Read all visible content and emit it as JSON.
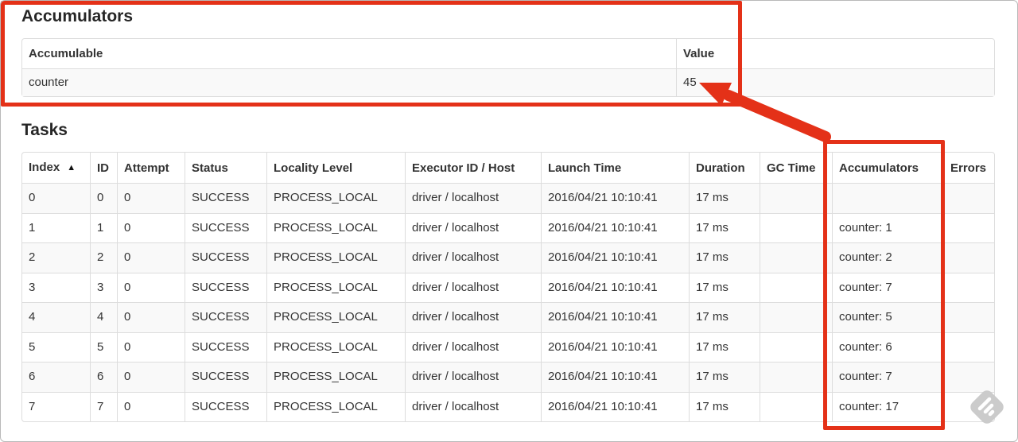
{
  "accumulators_section": {
    "heading": "Accumulators",
    "table": {
      "headers": [
        "Accumulable",
        "Value"
      ],
      "rows": [
        {
          "accumulable": "counter",
          "value": "45"
        }
      ]
    }
  },
  "tasks_section": {
    "heading": "Tasks",
    "table": {
      "headers": [
        "Index",
        "ID",
        "Attempt",
        "Status",
        "Locality Level",
        "Executor ID / Host",
        "Launch Time",
        "Duration",
        "GC Time",
        "Accumulators",
        "Errors"
      ],
      "sort": {
        "column": "Index",
        "direction": "asc",
        "icon": "▲"
      },
      "rows": [
        {
          "index": "0",
          "id": "0",
          "attempt": "0",
          "status": "SUCCESS",
          "locality_level": "PROCESS_LOCAL",
          "executor_id_host": "driver / localhost",
          "launch_time": "2016/04/21 10:10:41",
          "duration": "17 ms",
          "gc_time": "",
          "accumulators": "",
          "errors": ""
        },
        {
          "index": "1",
          "id": "1",
          "attempt": "0",
          "status": "SUCCESS",
          "locality_level": "PROCESS_LOCAL",
          "executor_id_host": "driver / localhost",
          "launch_time": "2016/04/21 10:10:41",
          "duration": "17 ms",
          "gc_time": "",
          "accumulators": "counter: 1",
          "errors": ""
        },
        {
          "index": "2",
          "id": "2",
          "attempt": "0",
          "status": "SUCCESS",
          "locality_level": "PROCESS_LOCAL",
          "executor_id_host": "driver / localhost",
          "launch_time": "2016/04/21 10:10:41",
          "duration": "17 ms",
          "gc_time": "",
          "accumulators": "counter: 2",
          "errors": ""
        },
        {
          "index": "3",
          "id": "3",
          "attempt": "0",
          "status": "SUCCESS",
          "locality_level": "PROCESS_LOCAL",
          "executor_id_host": "driver / localhost",
          "launch_time": "2016/04/21 10:10:41",
          "duration": "17 ms",
          "gc_time": "",
          "accumulators": "counter: 7",
          "errors": ""
        },
        {
          "index": "4",
          "id": "4",
          "attempt": "0",
          "status": "SUCCESS",
          "locality_level": "PROCESS_LOCAL",
          "executor_id_host": "driver / localhost",
          "launch_time": "2016/04/21 10:10:41",
          "duration": "17 ms",
          "gc_time": "",
          "accumulators": "counter: 5",
          "errors": ""
        },
        {
          "index": "5",
          "id": "5",
          "attempt": "0",
          "status": "SUCCESS",
          "locality_level": "PROCESS_LOCAL",
          "executor_id_host": "driver / localhost",
          "launch_time": "2016/04/21 10:10:41",
          "duration": "17 ms",
          "gc_time": "",
          "accumulators": "counter: 6",
          "errors": ""
        },
        {
          "index": "6",
          "id": "6",
          "attempt": "0",
          "status": "SUCCESS",
          "locality_level": "PROCESS_LOCAL",
          "executor_id_host": "driver / localhost",
          "launch_time": "2016/04/21 10:10:41",
          "duration": "17 ms",
          "gc_time": "",
          "accumulators": "counter: 7",
          "errors": ""
        },
        {
          "index": "7",
          "id": "7",
          "attempt": "0",
          "status": "SUCCESS",
          "locality_level": "PROCESS_LOCAL",
          "executor_id_host": "driver / localhost",
          "launch_time": "2016/04/21 10:10:41",
          "duration": "17 ms",
          "gc_time": "",
          "accumulators": "counter: 17",
          "errors": ""
        }
      ]
    }
  },
  "annotations": {
    "highlight_color": "#e43118"
  },
  "watermark": {
    "color": "#cbcbcb"
  }
}
